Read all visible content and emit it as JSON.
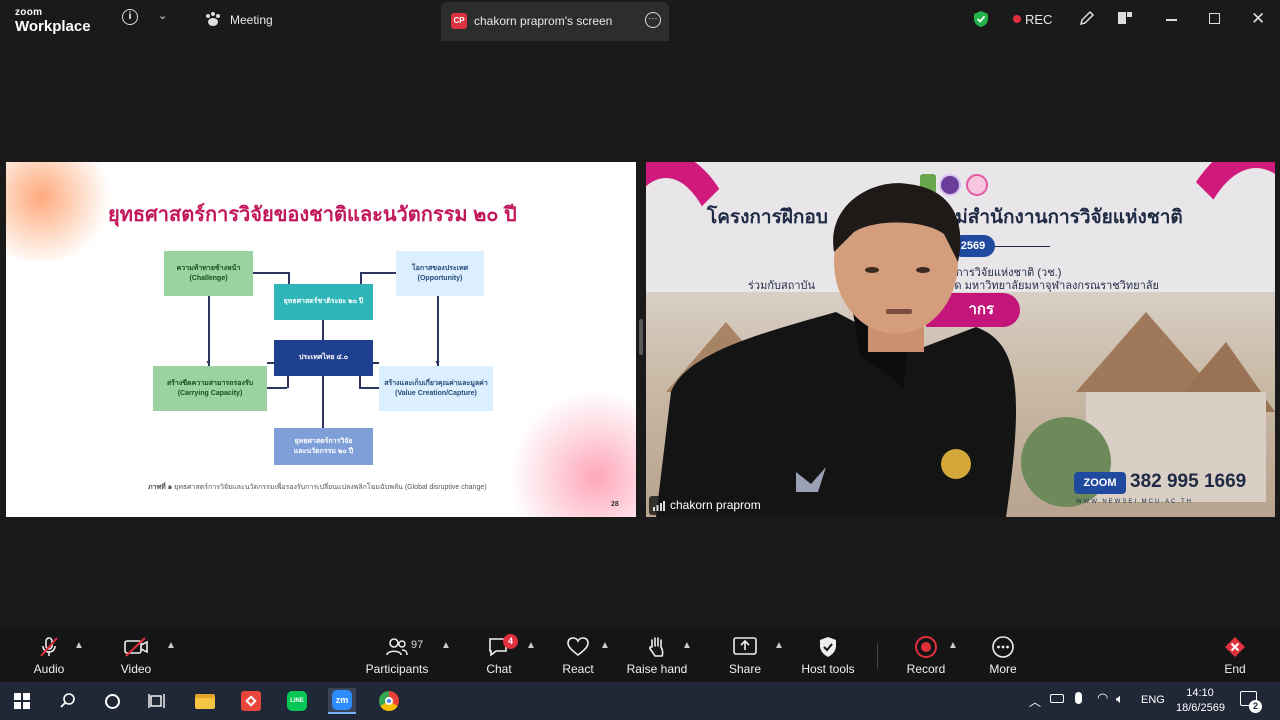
{
  "titlebar": {
    "brand_small": "zoom",
    "brand_big": "Workplace",
    "meeting_label": "Meeting",
    "screen_badge": "CP",
    "screen_tab_label": "chakorn praprom's screen",
    "rec_label": "REC"
  },
  "slide": {
    "title": "ยุทธศาสตร์การวิจัยของชาติและนวัตกรรม ๒๐ ปี",
    "boxes": {
      "challenge_line1": "ความท้าทายข้างหน้า",
      "challenge_line2": "(Challenge)",
      "opportunity_line1": "โอกาสของประเทศ",
      "opportunity_line2": "(Opportunity)",
      "strategy": "ยุทธศาสตร์ชาติระยะ ๒๐ ปี",
      "thailand": "ประเทศไทย ๔.๐",
      "capacity_line1": "สร้างขีดความสามารถรองรับ",
      "capacity_line2": "(Carrying Capacity)",
      "value_line1": "สร้างและเก็บเกี่ยวคุณค่าและมูลค่า",
      "value_line2": "(Value Creation/Capture)",
      "research_line1": "ยุทธศาสตร์การวิจัย",
      "research_line2": "และนวัตกรรม ๒๐ ปี"
    },
    "caption_label": "ภาพที่ ๑",
    "caption_text": "ยุทธศาสตร์การวิจัยและนวัตกรรมเพื่อรองรับการเปลี่ยนแปลงพลิกโฉมฉับพลัน (Global disruptive change)",
    "page_number": "28"
  },
  "video": {
    "banner_title": "โครงการฝึกอบ                    ใหม่สำนักงานการวิจัยแห่งชาติ",
    "year_badge": "2569",
    "sub_line1": "การวิจัยแห่งชาติ (วช.)",
    "sub_line2": "ร่วมกับสถาบัน                                    ร้อยเอ็ด มหาวิทยาลัยมหาจุฬาลงกรณราชวิทยาลัย",
    "pink_pill": "ากร",
    "zoom_badge": "ZOOM",
    "meeting_id": "382 995 1669",
    "website": "WWW.NEWSEI.MCU.AC.TH",
    "participant_name": "chakorn praprom"
  },
  "toolbar": {
    "audio": "Audio",
    "video": "Video",
    "participants": "Participants",
    "participants_count": "97",
    "chat": "Chat",
    "chat_badge": "4",
    "react": "React",
    "raise_hand": "Raise hand",
    "share": "Share",
    "host_tools": "Host tools",
    "record": "Record",
    "more": "More",
    "end": "End"
  },
  "taskbar": {
    "language": "ENG",
    "time": "14:10",
    "date": "18/6/2569",
    "notification_count": "2",
    "zoom_app": "zm"
  },
  "colors": {
    "slide_title": "#c2185b",
    "record_red": "#e02f3d",
    "shield_green": "#24b34a",
    "end_red": "#e0333d"
  }
}
